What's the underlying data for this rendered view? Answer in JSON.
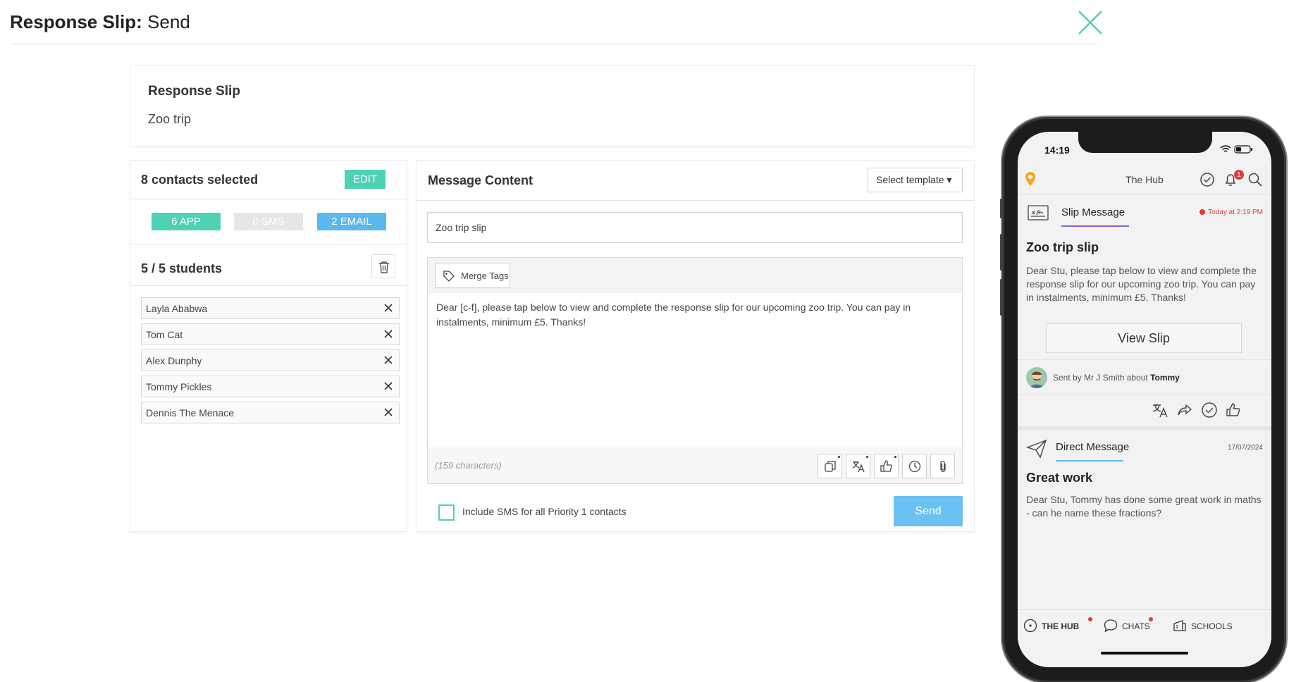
{
  "header": {
    "title_bold": "Response Slip:",
    "title_rest": " Send"
  },
  "summary": {
    "label": "Response Slip",
    "value": "Zoo trip"
  },
  "contacts": {
    "count_label": "8 contacts selected",
    "edit_label": "EDIT",
    "channels": {
      "app": "6 APP",
      "sms": "0 SMS",
      "email": "2 EMAIL"
    },
    "students_label": "5 / 5 students",
    "students": [
      "Layla Ababwa",
      "Tom Cat",
      "Alex Dunphy",
      "Tommy Pickles",
      "Dennis The Menace"
    ]
  },
  "message": {
    "title": "Message Content",
    "template_label": "Select template ▾",
    "subject": "Zoo trip slip",
    "merge_tags_label": "Merge Tags",
    "body": "Dear [c-f], please tap below to view and complete the response slip for our upcoming zoo trip. You can pay in instalments, minimum £5. Thanks!",
    "char_count": "(159 characters)",
    "sms_checkbox_label": "Include SMS for all Priority 1 contacts",
    "send_label": "Send"
  },
  "phone": {
    "time": "14:19",
    "app_title": "The Hub",
    "notification_count": "1",
    "slip": {
      "type": "Slip Message",
      "time": "Today at 2:19 PM",
      "title": "Zoo trip slip",
      "body": "Dear Stu, please tap below to view and complete the response slip for our upcoming zoo trip. You can pay in instalments, minimum £5. Thanks!",
      "button": "View Slip",
      "sent_by": "Sent by Mr J Smith about ",
      "about": "Tommy"
    },
    "dm": {
      "type": "Direct Message",
      "date": "17/07/2024",
      "title": "Great work",
      "body": "Dear Stu, Tommy has done some great work in maths - can he name these fractions?"
    },
    "tabs": {
      "hub": "THE HUB",
      "chats": "CHATS",
      "schools": "SCHOOLS"
    }
  },
  "colors": {
    "teal": "#4fd1b5",
    "blue": "#5ab8f0",
    "send": "#6bc1f2",
    "red": "#e53935"
  }
}
